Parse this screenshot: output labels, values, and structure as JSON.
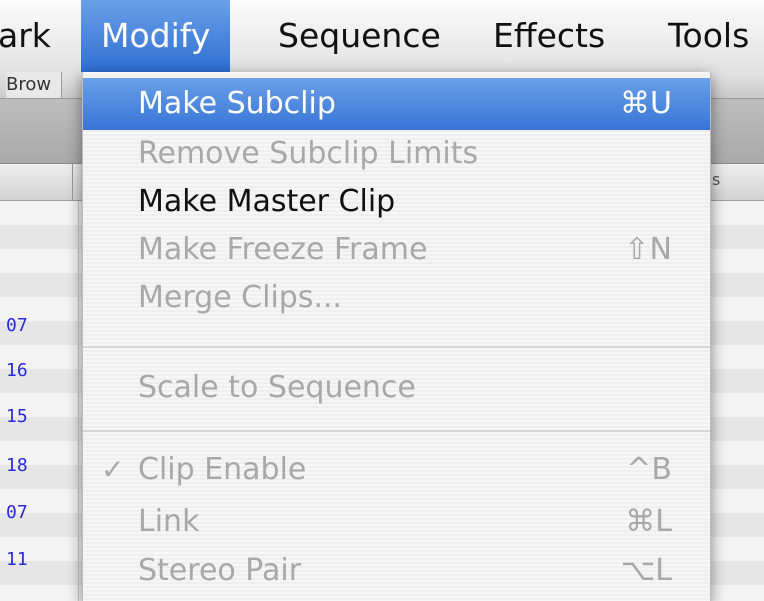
{
  "menubar": {
    "items": [
      "ark",
      "Modify",
      "Sequence",
      "Effects",
      "Tools"
    ],
    "active_index": 1
  },
  "background": {
    "tab_label": "Brow",
    "header_partial": "s",
    "row_numbers": [
      "07",
      "16",
      "15",
      "18",
      "07",
      "11"
    ]
  },
  "dropdown": {
    "items": [
      {
        "label": "Make Subclip",
        "shortcut": "⌘U",
        "enabled": true,
        "highlighted": true,
        "checked": false
      },
      {
        "label": "Remove Subclip Limits",
        "shortcut": "",
        "enabled": false,
        "highlighted": false,
        "checked": false
      },
      {
        "label": "Make Master Clip",
        "shortcut": "",
        "enabled": true,
        "highlighted": false,
        "checked": false
      },
      {
        "label": "Make Freeze Frame",
        "shortcut": "⇧N",
        "enabled": false,
        "highlighted": false,
        "checked": false
      },
      {
        "label": "Merge Clips...",
        "shortcut": "",
        "enabled": false,
        "highlighted": false,
        "checked": false
      },
      {
        "label": "Scale to Sequence",
        "shortcut": "",
        "enabled": false,
        "highlighted": false,
        "checked": false
      },
      {
        "label": "Clip Enable",
        "shortcut": "^B",
        "enabled": false,
        "highlighted": false,
        "checked": true
      },
      {
        "label": "Link",
        "shortcut": "⌘L",
        "enabled": false,
        "highlighted": false,
        "checked": false
      },
      {
        "label": "Stereo Pair",
        "shortcut": "⌥L",
        "enabled": false,
        "highlighted": false,
        "checked": false
      }
    ],
    "check_glyph": "✓"
  },
  "colors": {
    "highlight": "#3774d6",
    "enabled_text": "#111111",
    "disabled_text": "#a8a8a8",
    "row_number": "#2a2ad6"
  }
}
